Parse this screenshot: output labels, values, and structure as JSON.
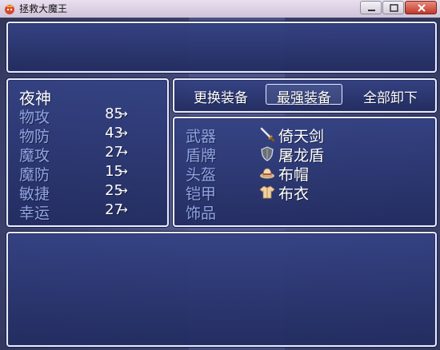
{
  "window": {
    "title": "拯救大魔王"
  },
  "help": {
    "text": ""
  },
  "status": {
    "actor_name": "夜神",
    "stats": [
      {
        "label": "物攻",
        "value": "85",
        "arrow": "→"
      },
      {
        "label": "物防",
        "value": "43",
        "arrow": "→"
      },
      {
        "label": "魔攻",
        "value": "27",
        "arrow": "→"
      },
      {
        "label": "魔防",
        "value": "15",
        "arrow": "→"
      },
      {
        "label": "敏捷",
        "value": "25",
        "arrow": "→"
      },
      {
        "label": "幸运",
        "value": "27",
        "arrow": "→"
      }
    ]
  },
  "commands": {
    "change": "更换装备",
    "optimize": "最强装备",
    "clear": "全部卸下",
    "selected": "最强装备"
  },
  "slots": [
    {
      "label": "武器",
      "item": "倚天剑",
      "icon": "sword-icon"
    },
    {
      "label": "盾牌",
      "item": "屠龙盾",
      "icon": "shield-icon"
    },
    {
      "label": "头盔",
      "item": "布帽",
      "icon": "hat-icon"
    },
    {
      "label": "铠甲",
      "item": "布衣",
      "icon": "clothes-icon"
    },
    {
      "label": "饰品",
      "item": "",
      "icon": ""
    }
  ],
  "colors": {
    "system_text": "#8fa4e6",
    "normal_text": "#ffffff",
    "window_border": "#e8ecff",
    "window_fill": "#2c3878"
  }
}
